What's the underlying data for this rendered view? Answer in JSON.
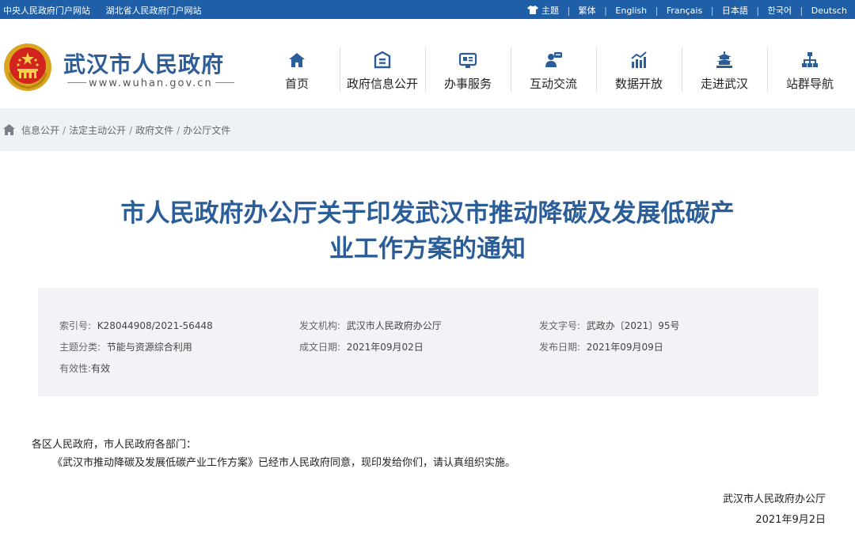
{
  "topbar": {
    "links_left": [
      "中央人民政府门户网站",
      "湖北省人民政府门户网站"
    ],
    "theme_label": "主题",
    "languages": [
      "繁体",
      "English",
      "Français",
      "日本語",
      "한국어",
      "Deutsch"
    ]
  },
  "site": {
    "title": "武汉市人民政府",
    "url": "www.wuhan.gov.cn"
  },
  "nav": [
    {
      "label": "首页",
      "icon": "home-icon"
    },
    {
      "label": "政府信息公开",
      "icon": "info-icon"
    },
    {
      "label": "办事服务",
      "icon": "service-icon"
    },
    {
      "label": "互动交流",
      "icon": "chat-icon"
    },
    {
      "label": "数据开放",
      "icon": "chart-icon"
    },
    {
      "label": "走进武汉",
      "icon": "pagoda-icon"
    },
    {
      "label": "站群导航",
      "icon": "sitemap-icon"
    }
  ],
  "breadcrumb": [
    "信息公开",
    "法定主动公开",
    "政府文件",
    "办公厅文件"
  ],
  "document": {
    "title_line1": "市人民政府办公厅关于印发武汉市推动降碳及发展低碳产",
    "title_line2": "业工作方案的通知",
    "meta": {
      "index_label": "索引号:",
      "index_value": "K28044908/2021-56448",
      "issuer_label": "发文机构:",
      "issuer_value": "武汉市人民政府办公厅",
      "docno_label": "发文字号:",
      "docno_value": "武政办〔2021〕95号",
      "topic_label": "主题分类:",
      "topic_value": "节能与资源综合利用",
      "written_label": "成文日期:",
      "written_value": "2021年09月02日",
      "publish_label": "发布日期:",
      "publish_value": "2021年09月09日",
      "validity_label": "有效性:",
      "validity_value": "有效"
    },
    "salutation": "各区人民政府，市人民政府各部门：",
    "paragraph": "《武汉市推动降碳及发展低碳产业工作方案》已经市人民政府同意，现印发给你们，请认真组织实施。",
    "signer": "武汉市人民政府办公厅",
    "date": "2021年9月2日"
  },
  "colors": {
    "topbar": "#1f5fa8",
    "title_blue": "#2b5e98",
    "crumb_bg": "#eef1f6",
    "meta_bg": "#f1f3f7"
  }
}
